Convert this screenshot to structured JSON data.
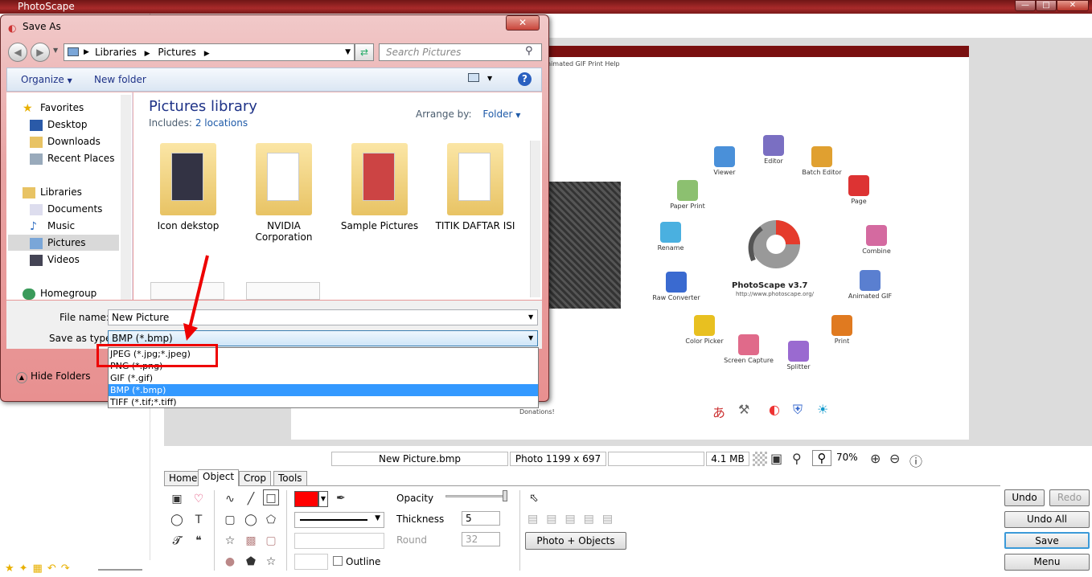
{
  "app": {
    "title": "PhotoScape"
  },
  "dialog": {
    "title": "Save As",
    "address": [
      "Libraries",
      "Pictures"
    ],
    "search_placeholder": "Search Pictures",
    "toolbar": {
      "organize": "Organize",
      "new_folder": "New folder"
    },
    "nav": {
      "favorites": "Favorites",
      "desktop": "Desktop",
      "downloads": "Downloads",
      "recent": "Recent Places",
      "libraries": "Libraries",
      "documents": "Documents",
      "music": "Music",
      "pictures": "Pictures",
      "videos": "Videos",
      "homegroup": "Homegroup"
    },
    "library": {
      "title": "Pictures library",
      "includes": "Includes:",
      "locations": "2 locations",
      "arrange_label": "Arrange by:",
      "arrange_value": "Folder"
    },
    "folders": [
      "Icon dekstop",
      "NVIDIA Corporation",
      "Sample Pictures",
      "TITIK DAFTAR ISI"
    ],
    "file_name_label": "File name:",
    "file_name": "New Picture",
    "save_type_label": "Save as type:",
    "save_type": "BMP (*.bmp)",
    "hide_folders": "Hide Folders",
    "type_options": [
      "JPEG (*.jpg;*.jpeg)",
      "PNG (*.png)",
      "GIF (*.gif)",
      "BMP (*.bmp)",
      "TIFF (*.tif;*.tiff)"
    ],
    "selected_option": "BMP (*.bmp)"
  },
  "canvas": {
    "menu": "nimated GIF  Print  Help",
    "logo_title": "PhotoScape v3.7",
    "logo_url": "http://www.photoscape.org/",
    "donations": "Donations!",
    "icons": [
      "Viewer",
      "Editor",
      "Batch Editor",
      "Page",
      "Combine",
      "Animated GIF",
      "Print",
      "Splitter",
      "Screen Capture",
      "Color Picker",
      "Raw Converter",
      "Rename",
      "Paper Print"
    ]
  },
  "status": {
    "filename": "New Picture.bmp",
    "photo": "Photo 1199 x 697",
    "size": "4.1 MB",
    "zoom": "70%"
  },
  "tabs": [
    "Home",
    "Object",
    "Crop",
    "Tools"
  ],
  "object_panel": {
    "opacity": "Opacity",
    "thickness": "Thickness",
    "thickness_value": "5",
    "round": "Round",
    "round_value": "32",
    "outline": "Outline",
    "photo_objects": "Photo + Objects"
  },
  "buttons": {
    "undo": "Undo",
    "redo": "Redo",
    "undo_all": "Undo All",
    "save": "Save",
    "menu": "Menu"
  },
  "colors": {
    "accent": "#3399ff",
    "highlight_box": "#e00000",
    "title_bar": "#a92a2a",
    "pen": "#ff0000"
  }
}
